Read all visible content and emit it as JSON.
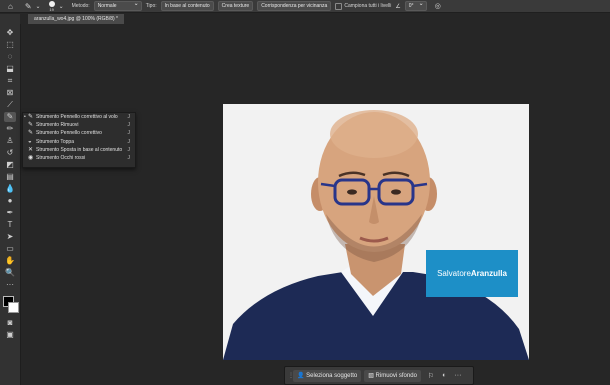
{
  "options_bar": {
    "brush_size": "19",
    "method_label": "Metodo:",
    "method_value": "Normale",
    "source_label": "Tipo:",
    "content_aware": "In base al contenuto",
    "create_texture": "Crea texture",
    "proximity_match": "Corrispondenza per vicinanza",
    "sample_all_layers": "Campiona tutti i livelli",
    "angle": "0°"
  },
  "document": {
    "tab_title": "aranzulla_wo4.jpg @ 100% (RGB/8) *"
  },
  "flyout": {
    "items": [
      {
        "label": "Strumento Pennello correttivo al volo",
        "key": "J",
        "active": true
      },
      {
        "label": "Strumento Rimuovi",
        "key": "J",
        "active": false
      },
      {
        "label": "Strumento Pennello correttivo",
        "key": "J",
        "active": false
      },
      {
        "label": "Strumento Toppa",
        "key": "J",
        "active": false
      },
      {
        "label": "Strumento Sposta in base al contenuto",
        "key": "J",
        "active": false
      },
      {
        "label": "Strumento Occhi rossi",
        "key": "J",
        "active": false
      }
    ]
  },
  "canvas": {
    "logo_text_light": "Salvatore",
    "logo_text_bold": "Aranzulla",
    "logo_color": "#1d8fc7"
  },
  "contextual_bar": {
    "select_subject": "Seleziona soggetto",
    "remove_background": "Rimuovi sfondo",
    "more": "···"
  }
}
